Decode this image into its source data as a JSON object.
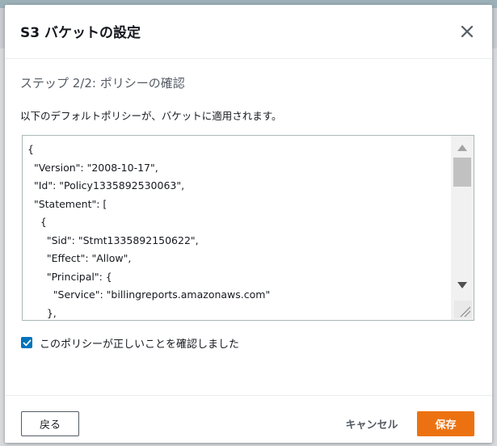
{
  "modal": {
    "title": "S3 バケットの設定",
    "step_title": "ステップ 2/2: ポリシーの確認",
    "description": "以下のデフォルトポリシーが、バケットに適用されます。",
    "policy_text": "{\n  \"Version\": \"2008-10-17\",\n  \"Id\": \"Policy1335892530063\",\n  \"Statement\": [\n    {\n      \"Sid\": \"Stmt1335892150622\",\n      \"Effect\": \"Allow\",\n      \"Principal\": {\n        \"Service\": \"billingreports.amazonaws.com\"\n      },",
    "confirm_label": "このポリシーが正しいことを確認しました",
    "confirm_checked": true
  },
  "footer": {
    "back_label": "戻る",
    "cancel_label": "キャンセル",
    "save_label": "保存"
  },
  "colors": {
    "primary": "#ec7211",
    "checkbox": "#0073bb",
    "text_secondary": "#545b64"
  },
  "icons": {
    "close": "close-icon",
    "check": "check-icon",
    "scroll_up": "scroll-up-icon",
    "scroll_down": "scroll-down-icon",
    "resize": "resize-grip-icon"
  }
}
